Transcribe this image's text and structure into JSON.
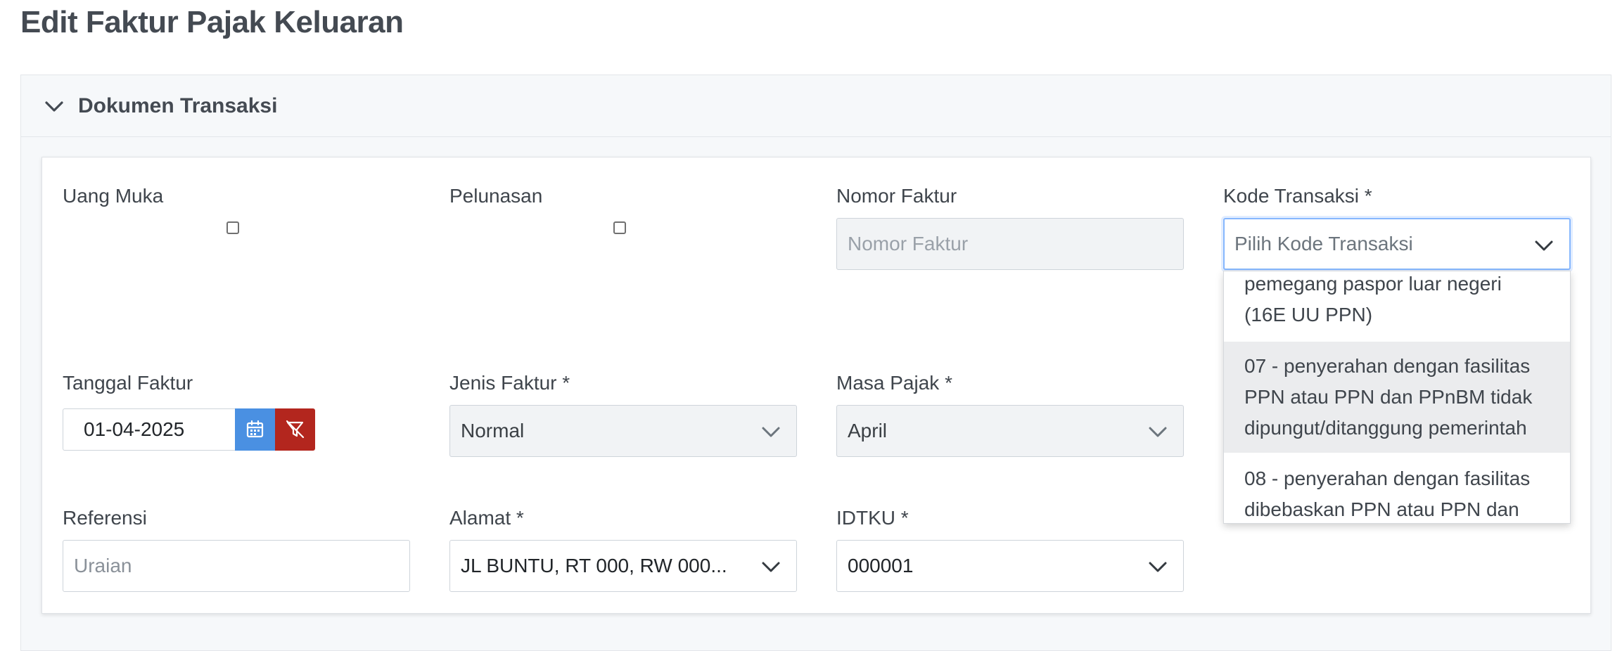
{
  "page": {
    "title": "Edit Faktur Pajak Keluaran"
  },
  "section": {
    "title": "Dokumen Transaksi"
  },
  "fields": {
    "uang_muka": {
      "label": "Uang Muka",
      "checked": false
    },
    "pelunasan": {
      "label": "Pelunasan",
      "checked": false
    },
    "nomor_faktur": {
      "label": "Nomor Faktur",
      "placeholder": "Nomor Faktur"
    },
    "kode_transaksi": {
      "label": "Kode Transaksi *",
      "placeholder": "Pilih Kode Transaksi"
    },
    "tanggal_faktur": {
      "label": "Tanggal Faktur",
      "value": "01-04-2025"
    },
    "jenis_faktur": {
      "label": "Jenis Faktur *",
      "value": "Normal"
    },
    "masa_pajak": {
      "label": "Masa Pajak *",
      "value": "April"
    },
    "referensi": {
      "label": "Referensi",
      "placeholder": "Uraian"
    },
    "alamat": {
      "label": "Alamat *",
      "value": "JL BUNTU, RT 000, RW 000..."
    },
    "idtku": {
      "label": "IDTKU *",
      "value": "000001"
    }
  },
  "dropdown": {
    "options": [
      {
        "lines": [
          "pemegang paspor luar negeri",
          "(16E UU PPN)"
        ]
      },
      {
        "lines": [
          "07 - penyerahan dengan fasilitas",
          "PPN atau PPN dan PPnBM tidak",
          "dipungut/ditanggung pemerintah"
        ],
        "highlighted": true
      },
      {
        "lines": [
          "08 - penyerahan dengan fasilitas",
          "dibebaskan PPN atau PPN dan"
        ]
      }
    ]
  },
  "icons": {
    "section_toggle": "chevron-down-icon",
    "select_arrow": "chevron-down-icon",
    "calendar": "calendar-icon",
    "clear_date": "filter-clear-icon"
  },
  "colors": {
    "calendar_button": "#4a90e2",
    "clear_button": "#b3261e",
    "focus_border": "#86b7fe",
    "highlight_option": "#ebecee"
  }
}
